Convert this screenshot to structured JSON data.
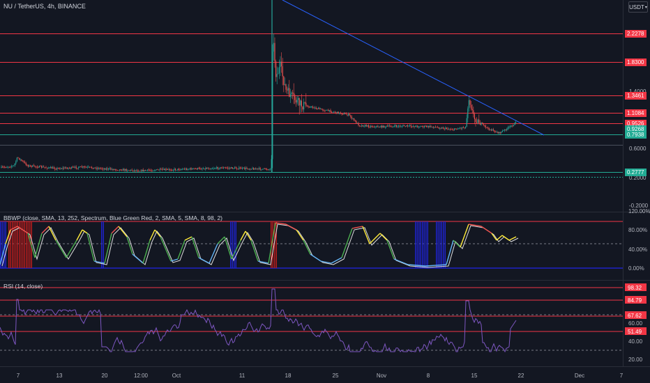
{
  "symbol_title": "NU / TetherUS, 4h, BINANCE",
  "currency_selector": "USDT",
  "colors": {
    "background": "#131722",
    "red_line": "#f23645",
    "green_line": "#22ab94",
    "trendline": "#2962ff",
    "rsi_line": "#7e57c2",
    "bbwp_low": "#1e22c8",
    "bbwp_high": "#b71c1c"
  },
  "main_axis": {
    "ticks": [
      "1.4000",
      "0.6000",
      "0.2000",
      "-0.2000"
    ]
  },
  "price_levels": [
    {
      "label": "2.2278",
      "kind": "red"
    },
    {
      "label": "1.8300",
      "kind": "red"
    },
    {
      "label": "1.3461",
      "kind": "red"
    },
    {
      "label": "1.1084",
      "kind": "red"
    },
    {
      "label": "0.9526",
      "kind": "red"
    },
    {
      "label": "0.9268",
      "kind": "current"
    },
    {
      "label": "0.7938",
      "kind": "green"
    },
    {
      "label": "0.2777",
      "kind": "green"
    }
  ],
  "bbwp": {
    "title": "BBWP (close, SMA, 13, 252, Spectrum, Blue Green Red, 2, SMA, 5, SMA, 8, 98, 2)",
    "ticks": [
      "120.00%",
      "80.00%",
      "40.00%",
      "0.00%"
    ]
  },
  "rsi": {
    "title": "RSI (14, close)",
    "ticks": [
      "60.00",
      "40.00",
      "20.00"
    ],
    "levels": [
      {
        "label": "98.32"
      },
      {
        "label": "84.79"
      },
      {
        "label": "67.62"
      },
      {
        "label": "51.49"
      }
    ]
  },
  "time_axis": [
    "7",
    "13",
    "20",
    "12:00",
    "Oct",
    "11",
    "18",
    "25",
    "Nov",
    "8",
    "15",
    "22",
    "Dec",
    "7"
  ]
}
